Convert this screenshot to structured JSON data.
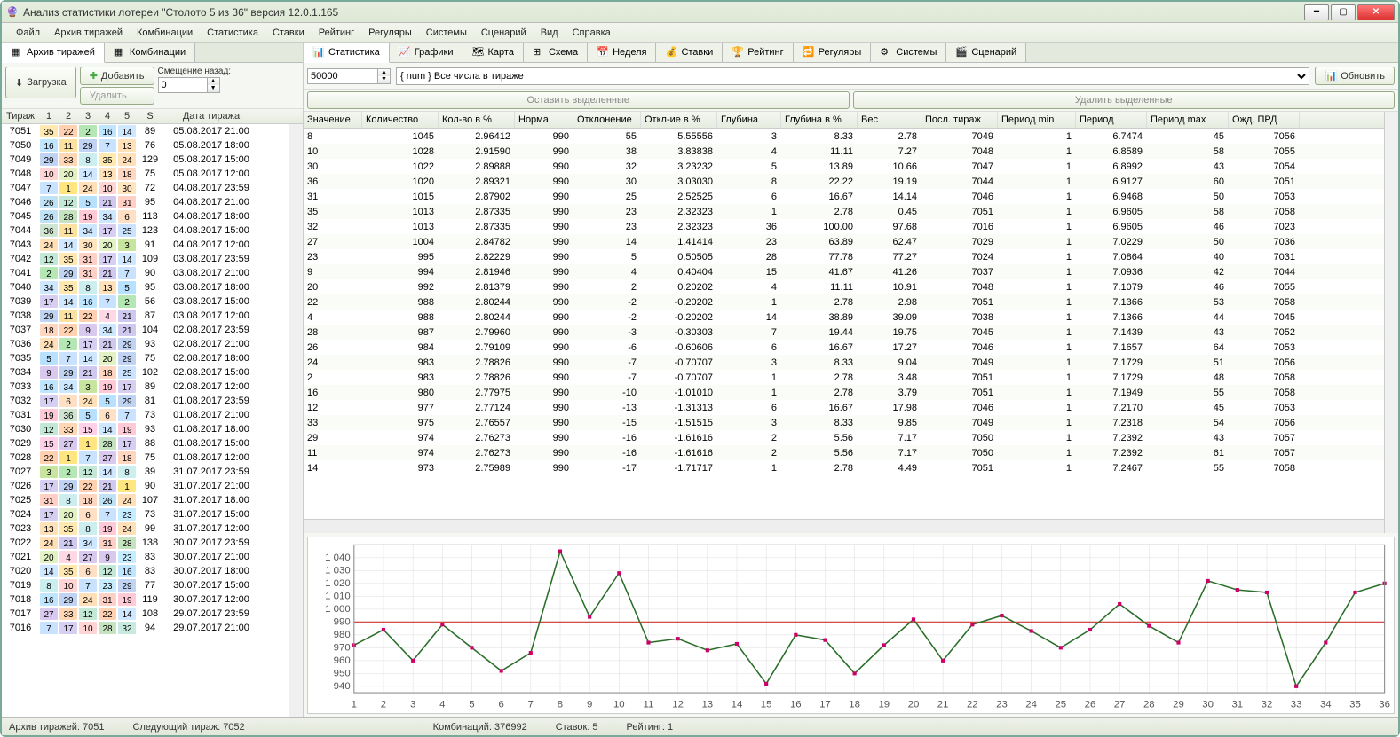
{
  "window": {
    "title": "Анализ статистики лотереи \"Столото 5 из 36\" версия 12.0.1.165"
  },
  "menu": [
    "Файл",
    "Архив тиражей",
    "Комбинации",
    "Статистика",
    "Ставки",
    "Рейтинг",
    "Регуляры",
    "Системы",
    "Сценарий",
    "Вид",
    "Справка"
  ],
  "left_tabs": [
    {
      "label": "Архив тиражей",
      "active": true
    },
    {
      "label": "Комбинации",
      "active": false
    }
  ],
  "left_buttons": {
    "load": "Загрузка",
    "add": "Добавить",
    "delete": "Удалить",
    "offset_label": "Смещение назад:",
    "offset_value": "0"
  },
  "archive": {
    "headers": [
      "Тираж",
      "1",
      "2",
      "3",
      "4",
      "5",
      "S",
      "Дата тиража"
    ],
    "rows": [
      {
        "d": 7051,
        "n": [
          35,
          22,
          2,
          16,
          14
        ],
        "s": 89,
        "date": "05.08.2017 21:00"
      },
      {
        "d": 7050,
        "n": [
          16,
          11,
          29,
          7,
          13
        ],
        "s": 76,
        "date": "05.08.2017 18:00"
      },
      {
        "d": 7049,
        "n": [
          29,
          33,
          8,
          35,
          24
        ],
        "s": 129,
        "date": "05.08.2017 15:00"
      },
      {
        "d": 7048,
        "n": [
          10,
          20,
          14,
          13,
          18
        ],
        "s": 75,
        "date": "05.08.2017 12:00"
      },
      {
        "d": 7047,
        "n": [
          7,
          1,
          24,
          10,
          30
        ],
        "s": 72,
        "date": "04.08.2017 23:59"
      },
      {
        "d": 7046,
        "n": [
          26,
          12,
          5,
          21,
          31
        ],
        "s": 95,
        "date": "04.08.2017 21:00"
      },
      {
        "d": 7045,
        "n": [
          26,
          28,
          19,
          34,
          6
        ],
        "s": 113,
        "date": "04.08.2017 18:00"
      },
      {
        "d": 7044,
        "n": [
          36,
          11,
          34,
          17,
          25
        ],
        "s": 123,
        "date": "04.08.2017 15:00"
      },
      {
        "d": 7043,
        "n": [
          24,
          14,
          30,
          20,
          3
        ],
        "s": 91,
        "date": "04.08.2017 12:00"
      },
      {
        "d": 7042,
        "n": [
          12,
          35,
          31,
          17,
          14
        ],
        "s": 109,
        "date": "03.08.2017 23:59"
      },
      {
        "d": 7041,
        "n": [
          2,
          29,
          31,
          21,
          7
        ],
        "s": 90,
        "date": "03.08.2017 21:00"
      },
      {
        "d": 7040,
        "n": [
          34,
          35,
          8,
          13,
          5
        ],
        "s": 95,
        "date": "03.08.2017 18:00"
      },
      {
        "d": 7039,
        "n": [
          17,
          14,
          16,
          7,
          2
        ],
        "s": 56,
        "date": "03.08.2017 15:00"
      },
      {
        "d": 7038,
        "n": [
          29,
          11,
          22,
          4,
          21
        ],
        "s": 87,
        "date": "03.08.2017 12:00"
      },
      {
        "d": 7037,
        "n": [
          18,
          22,
          9,
          34,
          21
        ],
        "s": 104,
        "date": "02.08.2017 23:59"
      },
      {
        "d": 7036,
        "n": [
          24,
          2,
          17,
          21,
          29
        ],
        "s": 93,
        "date": "02.08.2017 21:00"
      },
      {
        "d": 7035,
        "n": [
          5,
          7,
          14,
          20,
          29
        ],
        "s": 75,
        "date": "02.08.2017 18:00"
      },
      {
        "d": 7034,
        "n": [
          9,
          29,
          21,
          18,
          25
        ],
        "s": 102,
        "date": "02.08.2017 15:00"
      },
      {
        "d": 7033,
        "n": [
          16,
          34,
          3,
          19,
          17
        ],
        "s": 89,
        "date": "02.08.2017 12:00"
      },
      {
        "d": 7032,
        "n": [
          17,
          6,
          24,
          5,
          29
        ],
        "s": 81,
        "date": "01.08.2017 23:59"
      },
      {
        "d": 7031,
        "n": [
          19,
          36,
          5,
          6,
          7
        ],
        "s": 73,
        "date": "01.08.2017 21:00"
      },
      {
        "d": 7030,
        "n": [
          12,
          33,
          15,
          14,
          19
        ],
        "s": 93,
        "date": "01.08.2017 18:00"
      },
      {
        "d": 7029,
        "n": [
          15,
          27,
          1,
          28,
          17
        ],
        "s": 88,
        "date": "01.08.2017 15:00"
      },
      {
        "d": 7028,
        "n": [
          22,
          1,
          7,
          27,
          18
        ],
        "s": 75,
        "date": "01.08.2017 12:00"
      },
      {
        "d": 7027,
        "n": [
          3,
          2,
          12,
          14,
          8
        ],
        "s": 39,
        "date": "31.07.2017 23:59"
      },
      {
        "d": 7026,
        "n": [
          17,
          29,
          22,
          21,
          1
        ],
        "s": 90,
        "date": "31.07.2017 21:00"
      },
      {
        "d": 7025,
        "n": [
          31,
          8,
          18,
          26,
          24
        ],
        "s": 107,
        "date": "31.07.2017 18:00"
      },
      {
        "d": 7024,
        "n": [
          17,
          20,
          6,
          7,
          23
        ],
        "s": 73,
        "date": "31.07.2017 15:00"
      },
      {
        "d": 7023,
        "n": [
          13,
          35,
          8,
          19,
          24
        ],
        "s": 99,
        "date": "31.07.2017 12:00"
      },
      {
        "d": 7022,
        "n": [
          24,
          21,
          34,
          31,
          28
        ],
        "s": 138,
        "date": "30.07.2017 23:59"
      },
      {
        "d": 7021,
        "n": [
          20,
          4,
          27,
          9,
          23
        ],
        "s": 83,
        "date": "30.07.2017 21:00"
      },
      {
        "d": 7020,
        "n": [
          14,
          35,
          6,
          12,
          16
        ],
        "s": 83,
        "date": "30.07.2017 18:00"
      },
      {
        "d": 7019,
        "n": [
          8,
          10,
          7,
          23,
          29
        ],
        "s": 77,
        "date": "30.07.2017 15:00"
      },
      {
        "d": 7018,
        "n": [
          16,
          29,
          24,
          31,
          19
        ],
        "s": 119,
        "date": "30.07.2017 12:00"
      },
      {
        "d": 7017,
        "n": [
          27,
          33,
          12,
          22,
          14
        ],
        "s": 108,
        "date": "29.07.2017 23:59"
      },
      {
        "d": 7016,
        "n": [
          7,
          17,
          10,
          28,
          32
        ],
        "s": 94,
        "date": "29.07.2017 21:00"
      }
    ]
  },
  "ball_colors": {
    "1": "#ffe680",
    "2": "#b5e7b5",
    "3": "#c7e59f",
    "4": "#ffd8e6",
    "5": "#b8e0ff",
    "6": "#ffe0c4",
    "7": "#c8e2ff",
    "8": "#cceeee",
    "9": "#d9c9ef",
    "10": "#ffd4d4",
    "11": "#fce2a0",
    "12": "#c4e8d6",
    "13": "#ffe1ba",
    "14": "#d0e8ff",
    "15": "#ffd1e8",
    "16": "#bfe5ff",
    "17": "#d6cff2",
    "18": "#ffd6c0",
    "19": "#ffc9d6",
    "20": "#e2f2c4",
    "21": "#d0c9ef",
    "22": "#ffd1b0",
    "23": "#c6ecff",
    "24": "#ffe0b8",
    "25": "#cbe3ff",
    "26": "#bfe2f5",
    "27": "#d9c9ef",
    "28": "#c6e3c0",
    "29": "#c0d3f2",
    "30": "#ffe4c0",
    "31": "#ffd0c6",
    "32": "#c8e9df",
    "33": "#ffd7b5",
    "34": "#cde7ff",
    "35": "#ffe9b0",
    "36": "#cfe5d2"
  },
  "right_tabs": [
    {
      "label": "Статистика",
      "active": true
    },
    {
      "label": "Графики"
    },
    {
      "label": "Карта"
    },
    {
      "label": "Схема"
    },
    {
      "label": "Неделя"
    },
    {
      "label": "Ставки"
    },
    {
      "label": "Рейтинг"
    },
    {
      "label": "Регуляры"
    },
    {
      "label": "Системы"
    },
    {
      "label": "Сценарий"
    }
  ],
  "right_toolbar": {
    "limit": "50000",
    "combo": "{ num } Все числа в тираже",
    "refresh": "Обновить",
    "keep_sel": "Оставить выделенные",
    "del_sel": "Удалить выделенные"
  },
  "stats": {
    "headers": [
      "Значение",
      "Количество",
      "Кол-во в %",
      "Норма",
      "Отклонение",
      "Откл-ие в %",
      "Глубина",
      "Глубина в %",
      "Вес",
      "Посл. тираж",
      "Период min",
      "Период",
      "Период max",
      "Ожд. ПРД"
    ],
    "rows": [
      [
        8,
        1045,
        "2.96412",
        990,
        55,
        "5.55556",
        3,
        "8.33",
        "2.78",
        7049,
        1,
        "6.7474",
        45,
        7056
      ],
      [
        10,
        1028,
        "2.91590",
        990,
        38,
        "3.83838",
        4,
        "11.11",
        "7.27",
        7048,
        1,
        "6.8589",
        58,
        7055
      ],
      [
        30,
        1022,
        "2.89888",
        990,
        32,
        "3.23232",
        5,
        "13.89",
        "10.66",
        7047,
        1,
        "6.8992",
        43,
        7054
      ],
      [
        36,
        1020,
        "2.89321",
        990,
        30,
        "3.03030",
        8,
        "22.22",
        "19.19",
        7044,
        1,
        "6.9127",
        60,
        7051
      ],
      [
        31,
        1015,
        "2.87902",
        990,
        25,
        "2.52525",
        6,
        "16.67",
        "14.14",
        7046,
        1,
        "6.9468",
        50,
        7053
      ],
      [
        35,
        1013,
        "2.87335",
        990,
        23,
        "2.32323",
        1,
        "2.78",
        "0.45",
        7051,
        1,
        "6.9605",
        58,
        7058
      ],
      [
        32,
        1013,
        "2.87335",
        990,
        23,
        "2.32323",
        36,
        "100.00",
        "97.68",
        7016,
        1,
        "6.9605",
        46,
        7023
      ],
      [
        27,
        1004,
        "2.84782",
        990,
        14,
        "1.41414",
        23,
        "63.89",
        "62.47",
        7029,
        1,
        "7.0229",
        50,
        7036
      ],
      [
        23,
        995,
        "2.82229",
        990,
        5,
        "0.50505",
        28,
        "77.78",
        "77.27",
        7024,
        1,
        "7.0864",
        40,
        7031
      ],
      [
        9,
        994,
        "2.81946",
        990,
        4,
        "0.40404",
        15,
        "41.67",
        "41.26",
        7037,
        1,
        "7.0936",
        42,
        7044
      ],
      [
        20,
        992,
        "2.81379",
        990,
        2,
        "0.20202",
        4,
        "11.11",
        "10.91",
        7048,
        1,
        "7.1079",
        46,
        7055
      ],
      [
        22,
        988,
        "2.80244",
        990,
        -2,
        "-0.20202",
        1,
        "2.78",
        "2.98",
        7051,
        1,
        "7.1366",
        53,
        7058
      ],
      [
        4,
        988,
        "2.80244",
        990,
        -2,
        "-0.20202",
        14,
        "38.89",
        "39.09",
        7038,
        1,
        "7.1366",
        44,
        7045
      ],
      [
        28,
        987,
        "2.79960",
        990,
        -3,
        "-0.30303",
        7,
        "19.44",
        "19.75",
        7045,
        1,
        "7.1439",
        43,
        7052
      ],
      [
        26,
        984,
        "2.79109",
        990,
        -6,
        "-0.60606",
        6,
        "16.67",
        "17.27",
        7046,
        1,
        "7.1657",
        64,
        7053
      ],
      [
        24,
        983,
        "2.78826",
        990,
        -7,
        "-0.70707",
        3,
        "8.33",
        "9.04",
        7049,
        1,
        "7.1729",
        51,
        7056
      ],
      [
        2,
        983,
        "2.78826",
        990,
        -7,
        "-0.70707",
        1,
        "2.78",
        "3.48",
        7051,
        1,
        "7.1729",
        48,
        7058
      ],
      [
        16,
        980,
        "2.77975",
        990,
        -10,
        "-1.01010",
        1,
        "2.78",
        "3.79",
        7051,
        1,
        "7.1949",
        55,
        7058
      ],
      [
        12,
        977,
        "2.77124",
        990,
        -13,
        "-1.31313",
        6,
        "16.67",
        "17.98",
        7046,
        1,
        "7.2170",
        45,
        7053
      ],
      [
        33,
        975,
        "2.76557",
        990,
        -15,
        "-1.51515",
        3,
        "8.33",
        "9.85",
        7049,
        1,
        "7.2318",
        54,
        7056
      ],
      [
        29,
        974,
        "2.76273",
        990,
        -16,
        "-1.61616",
        2,
        "5.56",
        "7.17",
        7050,
        1,
        "7.2392",
        43,
        7057
      ],
      [
        11,
        974,
        "2.76273",
        990,
        -16,
        "-1.61616",
        2,
        "5.56",
        "7.17",
        7050,
        1,
        "7.2392",
        61,
        7057
      ],
      [
        14,
        973,
        "2.75989",
        990,
        -17,
        "-1.71717",
        1,
        "2.78",
        "4.49",
        7051,
        1,
        "7.2467",
        55,
        7058
      ]
    ]
  },
  "chart_data": {
    "type": "line",
    "title": "",
    "xlabel": "",
    "ylabel": "",
    "x": [
      1,
      2,
      3,
      4,
      5,
      6,
      7,
      8,
      9,
      10,
      11,
      12,
      13,
      14,
      15,
      16,
      17,
      18,
      19,
      20,
      21,
      22,
      23,
      24,
      25,
      26,
      27,
      28,
      29,
      30,
      31,
      32,
      33,
      34,
      35,
      36
    ],
    "values": [
      972,
      984,
      960,
      988,
      970,
      952,
      966,
      1045,
      994,
      1028,
      974,
      977,
      968,
      973,
      942,
      980,
      976,
      950,
      972,
      992,
      960,
      988,
      995,
      983,
      970,
      984,
      1004,
      987,
      974,
      1022,
      1015,
      1013,
      940,
      974,
      1013,
      1020
    ],
    "yticks": [
      940,
      950,
      960,
      970,
      980,
      990,
      1000,
      1010,
      1020,
      1030,
      1040
    ],
    "ylim": [
      935,
      1050
    ],
    "reference_line": 990
  },
  "status": {
    "archive": "Архив тиражей: 7051",
    "next": "Следующий тираж: 7052",
    "combos": "Комбинаций: 376992",
    "bets": "Ставок: 5",
    "rating": "Рейтинг: 1"
  }
}
